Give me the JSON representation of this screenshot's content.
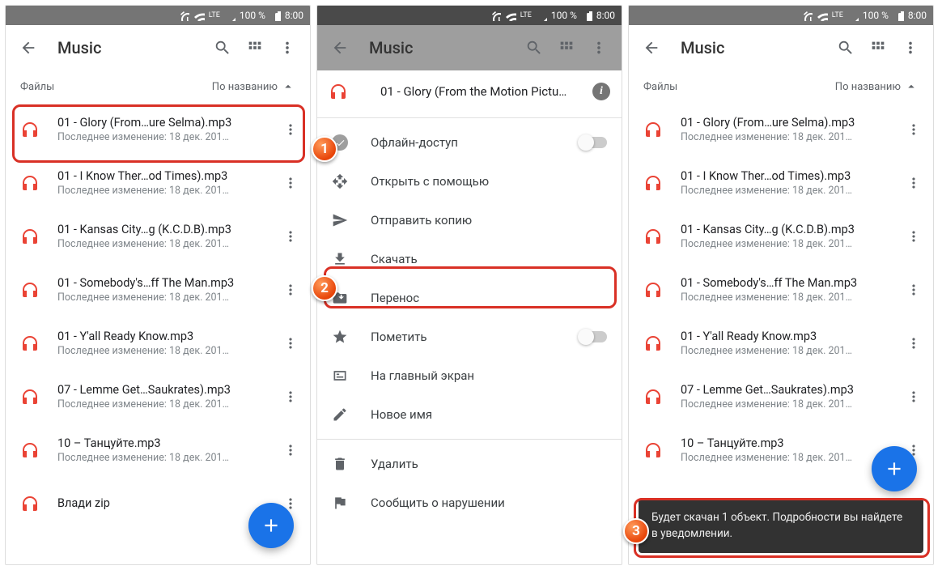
{
  "status": {
    "battery": "100 %",
    "time": "8:00",
    "lte": "LTE"
  },
  "appbar": {
    "title": "Music"
  },
  "subhead": {
    "left": "Файлы",
    "sort": "По названию"
  },
  "files": [
    {
      "name": "01 - Glory (From…ure Selma).mp3",
      "sub": "Последнее изменение: 18 дек. 201…"
    },
    {
      "name": "01 - I Know Ther…od Times).mp3",
      "sub": "Последнее изменение: 18 дек. 201…"
    },
    {
      "name": "01 - Kansas City…g (K.C.D.B).mp3",
      "sub": "Последнее изменение: 18 дек. 201…"
    },
    {
      "name": "01 - Somebody's…ff The Man.mp3",
      "sub": "Последнее изменение: 18 дек. 201…"
    },
    {
      "name": "01 - Y'all Ready Know.mp3",
      "sub": "Последнее изменение: 18 дек. 201…"
    },
    {
      "name": "07 - Lemme Get…Saukrates).mp3",
      "sub": "Последнее изменение: 18 дек. 201…"
    },
    {
      "name": "10 – Танцуйте.mp3",
      "sub": "Последнее изменение: 18 дек. 201…"
    },
    {
      "name": "Влади zip",
      "sub": ""
    }
  ],
  "sheet": {
    "title": "01 - Glory (From the Motion Pictu…",
    "items": {
      "offline": "Офлайн-доступ",
      "openwith": "Открыть с помощью",
      "sendcopy": "Отправить копию",
      "download": "Скачать",
      "move": "Перенос",
      "star": "Пометить",
      "homescreen": "На главный экран",
      "rename": "Новое имя",
      "delete": "Удалить",
      "report": "Сообщить о нарушении"
    }
  },
  "toast": "Будет скачан 1 объект. Подробности вы найдете в уведомлении.",
  "badges": {
    "b1": "1",
    "b2": "2",
    "b3": "3"
  }
}
